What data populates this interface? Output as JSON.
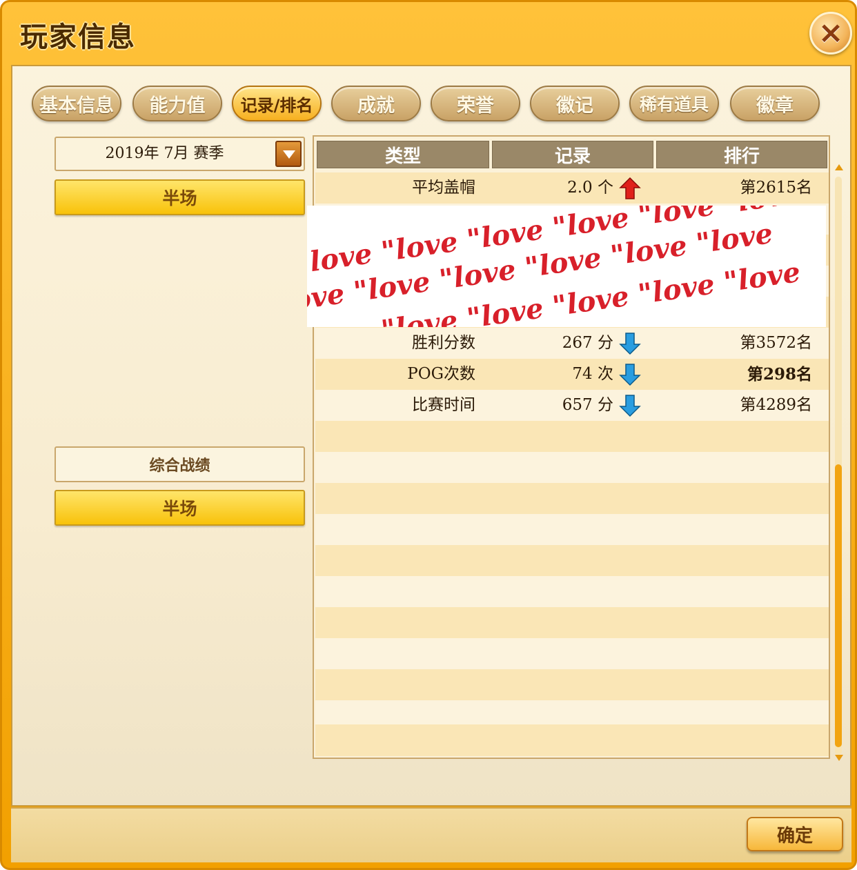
{
  "window": {
    "title": "玩家信息"
  },
  "tabs": [
    {
      "label": "基本信息",
      "active": false
    },
    {
      "label": "能力值",
      "active": false
    },
    {
      "label": "记录/排名",
      "active": true
    },
    {
      "label": "成就",
      "active": false
    },
    {
      "label": "荣誉",
      "active": false
    },
    {
      "label": "徽记",
      "active": false
    },
    {
      "label": "稀有道具",
      "active": false
    },
    {
      "label": "徽章",
      "active": false
    }
  ],
  "sidebar": {
    "season_select": "2019年 7月 赛季",
    "mode_button_1": "半场",
    "overall_label": "综合战绩",
    "mode_button_2": "半场"
  },
  "table": {
    "headers": [
      "类型",
      "记录",
      "排行"
    ],
    "rows": [
      {
        "type": "平均盖帽",
        "value": "2.0 个",
        "trend": "up",
        "rank": "第2615名",
        "bold": false
      },
      {
        "type": "胜利分数",
        "value": "267 分",
        "trend": "down",
        "rank": "第3572名",
        "bold": false
      },
      {
        "type": "POG次数",
        "value": "74 次",
        "trend": "down",
        "rank": "第298名",
        "bold": true
      },
      {
        "type": "比赛时间",
        "value": "657 分",
        "trend": "down",
        "rank": "第4289名",
        "bold": false
      }
    ]
  },
  "overlay": {
    "text": "\"love \"love \"love \"love \"love \"love"
  },
  "footer": {
    "confirm": "确定"
  },
  "colors": {
    "up_arrow": "#e0201a",
    "down_arrow": "#2a9de0",
    "accent": "#f7b020"
  }
}
